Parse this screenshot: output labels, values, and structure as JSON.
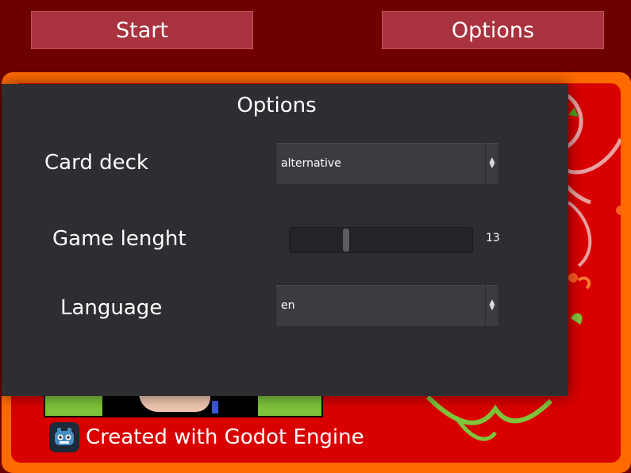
{
  "menu": {
    "start_label": "Start",
    "options_label": "Options"
  },
  "credit": {
    "text": "Created with Godot Engine",
    "logo_icon": "godot-logo-icon"
  },
  "options_dialog": {
    "title": "Options",
    "card_deck": {
      "label": "Card deck",
      "value": "alternative"
    },
    "game_length": {
      "label": "Game lenght",
      "value": "13",
      "fraction": 0.3
    },
    "language": {
      "label": "Language",
      "value": "en"
    }
  },
  "colors": {
    "background": "#6e0000",
    "button": "#a8323e",
    "board_border": "#ff6a00",
    "board": "#d90000",
    "dialog": "#2e2e32",
    "leaf_green": "#7fc43a"
  }
}
